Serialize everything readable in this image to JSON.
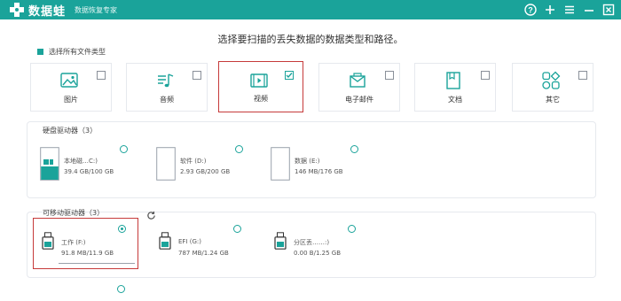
{
  "app": {
    "name": "数据蛙",
    "subtitle": "数据恢复专家"
  },
  "window_controls": [
    "help-icon",
    "add-icon",
    "menu-icon",
    "minimize-icon",
    "close-icon"
  ],
  "heading": "选择要扫描的丢失数据的数据类型和路径。",
  "select_all": {
    "label": "选择所有文件类型",
    "checked": true
  },
  "file_types": [
    {
      "label": "图片",
      "icon": "image-icon",
      "checked": false
    },
    {
      "label": "音频",
      "icon": "audio-icon",
      "checked": false
    },
    {
      "label": "视频",
      "icon": "video-icon",
      "checked": true
    },
    {
      "label": "电子邮件",
      "icon": "email-icon",
      "checked": false
    },
    {
      "label": "文档",
      "icon": "document-icon",
      "checked": false
    },
    {
      "label": "其它",
      "icon": "other-icon",
      "checked": false
    }
  ],
  "hard_drives": {
    "title": "硬盘驱动器（3）",
    "items": [
      {
        "name": "本地磁…C:)",
        "size": "39.4 GB/100 GB",
        "used_fraction": 0.394,
        "selected": false
      },
      {
        "name": "软件 (D:)",
        "size": "2.93 GB/200 GB",
        "used_fraction": 0.015,
        "selected": false
      },
      {
        "name": "数据 (E:)",
        "size": "146 MB/176 GB",
        "used_fraction": 0.001,
        "selected": false
      }
    ]
  },
  "removable_drives": {
    "title": "可移动驱动器（3）",
    "items": [
      {
        "name": "工作 (F:)",
        "size": "91.8 MB/11.9 GB",
        "selected": true
      },
      {
        "name": "EFI (G:)",
        "size": "787 MB/1.24 GB",
        "selected": false
      },
      {
        "name": "分区丢……:)",
        "size": "0.00  B/1.25 GB",
        "selected": false
      }
    ]
  },
  "colors": {
    "accent": "#1aa39a",
    "highlight": "#c63a3a"
  }
}
